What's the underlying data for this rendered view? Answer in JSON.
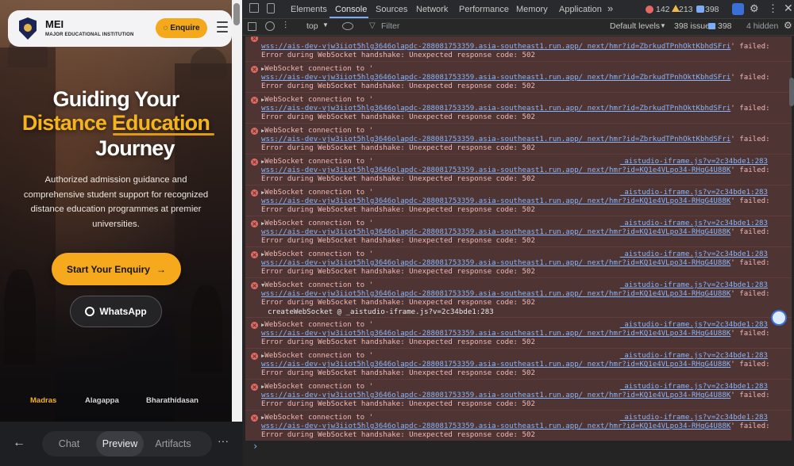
{
  "preview": {
    "brand_name": "MEI",
    "brand_sub": "MAJOR EDUCATIONAL INSTITUTION",
    "enquire_label": "Enquire",
    "hero_line1": "Guiding Your",
    "hero_line2_a": "Distance ",
    "hero_line2_b": "Education",
    "hero_line3": "Journey",
    "description": "Authorized admission guidance and comprehensive student support for recognized distance education programmes at premier universities.",
    "cta_label": "Start Your Enquiry",
    "cta_arrow": "→",
    "whatsapp_label": "WhatsApp",
    "universities": [
      "Madras",
      "Alagappa",
      "Bharathidasan"
    ]
  },
  "bottom_bar": {
    "back": "←",
    "tabs": [
      "Chat",
      "Preview",
      "Artifacts"
    ],
    "more": "···"
  },
  "devtools": {
    "tabs": [
      "Elements",
      "Console",
      "Sources",
      "Network",
      "Performance",
      "Memory",
      "Application"
    ],
    "more_tabs": "»",
    "error_count": "142",
    "warning_count": "213",
    "issue_count": "398",
    "toolbar": {
      "context": "top",
      "filter_placeholder": "Filter",
      "levels": "Default levels",
      "issues_label": "398 issues:",
      "issues_num": "398",
      "hidden": "4 hidden"
    },
    "colors": {
      "error_bg": "#4e3534",
      "error_text": "#f2b8b5",
      "link": "#8ab4f8"
    },
    "messages": [
      {
        "first": "",
        "url": "wss://ais-dev-vjw3iiot5hlg3646olapdc-288081753359.asia-southeast1.run.app/_next/hmr?id=ZbrkudTPnhOktKbhdSFri",
        "tail": "' failed:",
        "err": "Error during WebSocket handshake: Unexpected response code: 502",
        "src": ""
      },
      {
        "first": "WebSocket connection to '",
        "url": "wss://ais-dev-vjw3iiot5hlg3646olapdc-288081753359.asia-southeast1.run.app/_next/hmr?id=ZbrkudTPnhOktKbhdSFri",
        "tail": "' failed:",
        "err": "Error during WebSocket handshake: Unexpected response code: 502",
        "src": ""
      },
      {
        "first": "WebSocket connection to '",
        "url": "wss://ais-dev-vjw3iiot5hlg3646olapdc-288081753359.asia-southeast1.run.app/_next/hmr?id=ZbrkudTPnhOktKbhdSFri",
        "tail": "' failed:",
        "err": "Error during WebSocket handshake: Unexpected response code: 502",
        "src": ""
      },
      {
        "first": "WebSocket connection to '",
        "url": "wss://ais-dev-vjw3iiot5hlg3646olapdc-288081753359.asia-southeast1.run.app/_next/hmr?id=ZbrkudTPnhOktKbhdSFri",
        "tail": "' failed:",
        "err": "Error during WebSocket handshake: Unexpected response code: 502",
        "src": ""
      },
      {
        "first": "WebSocket connection to '",
        "url": "wss://ais-dev-vjw3iiot5hlg3646olapdc-288081753359.asia-southeast1.run.app/_next/hmr?id=KQ1e4VLpo34-RHqG4U88K",
        "tail": "' failed:",
        "err": "Error during WebSocket handshake: Unexpected response code: 502",
        "src": "_aistudio-iframe.js?v=2c34bde1:283"
      },
      {
        "first": "WebSocket connection to '",
        "url": "wss://ais-dev-vjw3iiot5hlg3646olapdc-288081753359.asia-southeast1.run.app/_next/hmr?id=KQ1e4VLpo34-RHqG4U88K",
        "tail": "' failed:",
        "err": "Error during WebSocket handshake: Unexpected response code: 502",
        "src": "_aistudio-iframe.js?v=2c34bde1:283"
      },
      {
        "first": "WebSocket connection to '",
        "url": "wss://ais-dev-vjw3iiot5hlg3646olapdc-288081753359.asia-southeast1.run.app/_next/hmr?id=KQ1e4VLpo34-RHqG4U88K",
        "tail": "' failed:",
        "err": "Error during WebSocket handshake: Unexpected response code: 502",
        "src": "_aistudio-iframe.js?v=2c34bde1:283"
      },
      {
        "first": "WebSocket connection to '",
        "url": "wss://ais-dev-vjw3iiot5hlg3646olapdc-288081753359.asia-southeast1.run.app/_next/hmr?id=KQ1e4VLpo34-RHqG4U88K",
        "tail": "' failed:",
        "err": "Error during WebSocket handshake: Unexpected response code: 502",
        "src": "_aistudio-iframe.js?v=2c34bde1:283"
      },
      {
        "first": "WebSocket connection to '",
        "url": "wss://ais-dev-vjw3iiot5hlg3646olapdc-288081753359.asia-southeast1.run.app/_next/hmr?id=KQ1e4VLpo34-RHqG4U88K",
        "tail": "' failed:",
        "err": "Error during WebSocket handshake: Unexpected response code: 502",
        "src": "_aistudio-iframe.js?v=2c34bde1:283",
        "expanded": true,
        "stack": "createWebSocket @ _aistudio-iframe.js?v=2c34bde1:283"
      },
      {
        "first": "WebSocket connection to '",
        "url": "wss://ais-dev-vjw3iiot5hlg3646olapdc-288081753359.asia-southeast1.run.app/_next/hmr?id=KQ1e4VLpo34-RHqG4U88K",
        "tail": "' failed:",
        "err": "Error during WebSocket handshake: Unexpected response code: 502",
        "src": "_aistudio-iframe.js?v=2c34bde1:283"
      },
      {
        "first": "WebSocket connection to '",
        "url": "wss://ais-dev-vjw3iiot5hlg3646olapdc-288081753359.asia-southeast1.run.app/_next/hmr?id=KQ1e4VLpo34-RHqG4U88K",
        "tail": "' failed:",
        "err": "Error during WebSocket handshake: Unexpected response code: 502",
        "src": "_aistudio-iframe.js?v=2c34bde1:283"
      },
      {
        "first": "WebSocket connection to '",
        "url": "wss://ais-dev-vjw3iiot5hlg3646olapdc-288081753359.asia-southeast1.run.app/_next/hmr?id=KQ1e4VLpo34-RHqG4U88K",
        "tail": "' failed:",
        "err": "Error during WebSocket handshake: Unexpected response code: 502",
        "src": "_aistudio-iframe.js?v=2c34bde1:283"
      },
      {
        "first": "WebSocket connection to '",
        "url": "wss://ais-dev-vjw3iiot5hlg3646olapdc-288081753359.asia-southeast1.run.app/_next/hmr?id=KQ1e4VLpo34-RHqG4U88K",
        "tail": "' failed:",
        "err": "Error during WebSocket handshake: Unexpected response code: 502",
        "src": "_aistudio-iframe.js?v=2c34bde1:283"
      }
    ],
    "prompt": "›"
  }
}
